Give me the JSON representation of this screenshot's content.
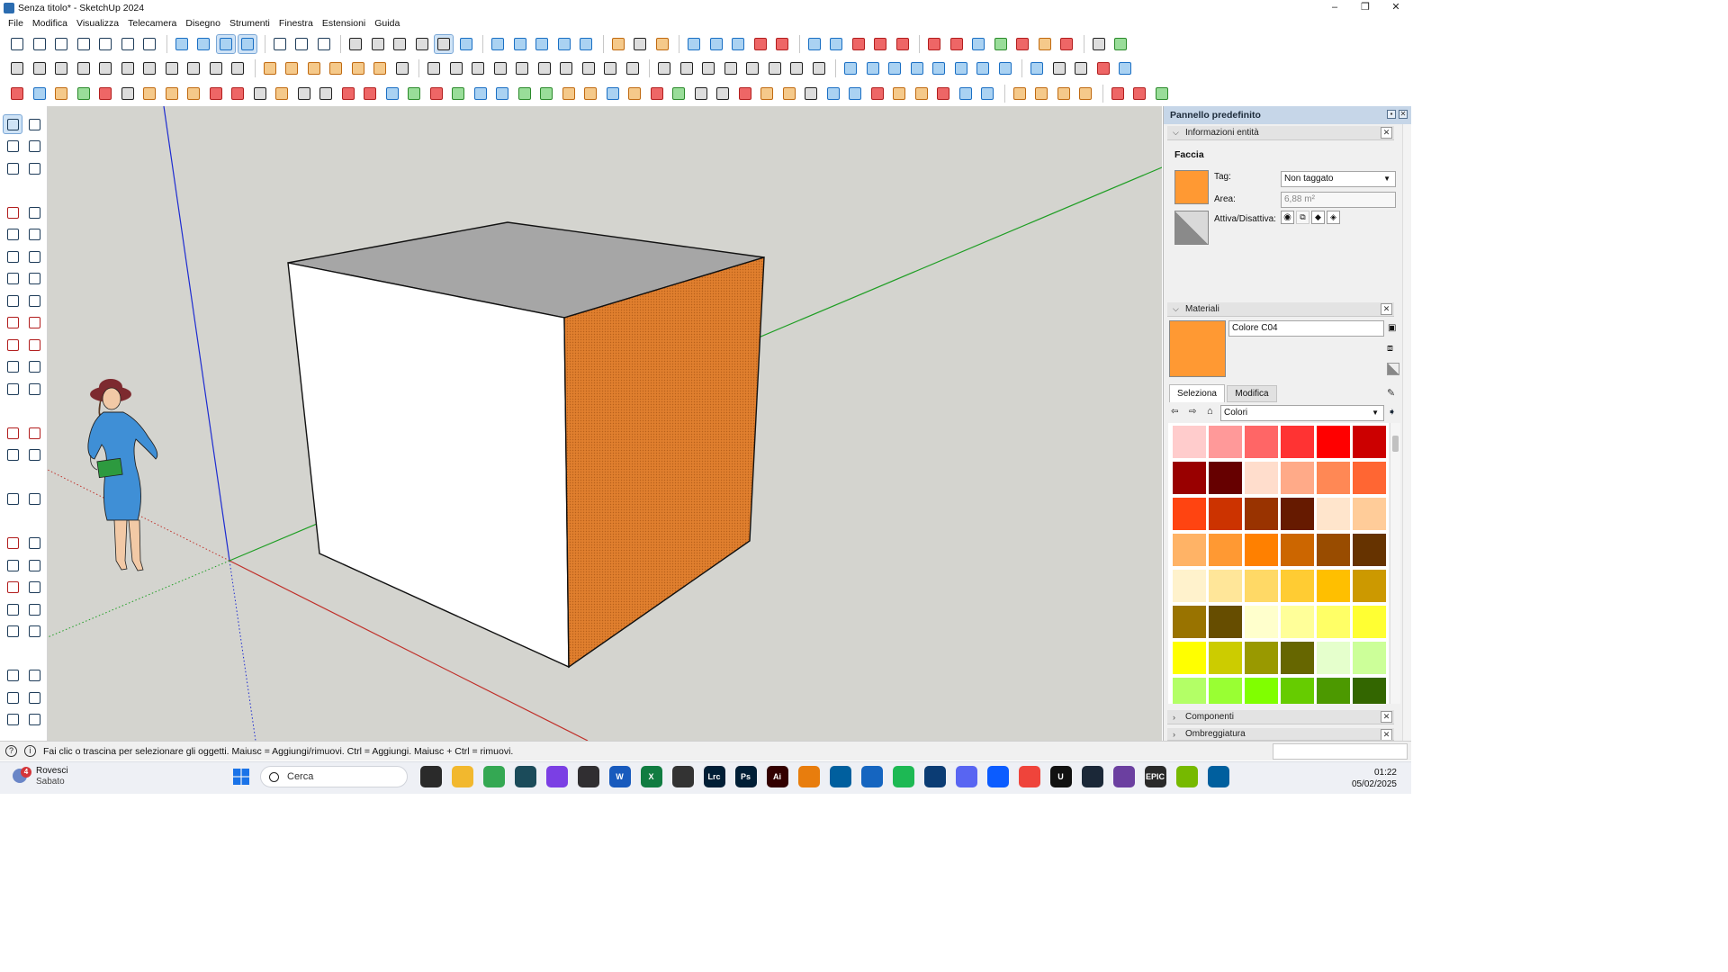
{
  "window": {
    "title": "Senza titolo* - SketchUp 2024",
    "controls": [
      "–",
      "❐",
      "✕"
    ]
  },
  "menu": [
    "File",
    "Modifica",
    "Visualizza",
    "Telecamera",
    "Disegno",
    "Strumenti",
    "Finestra",
    "Estensioni",
    "Guida"
  ],
  "right_panel": {
    "title": "Pannello predefinito",
    "entity_info": {
      "header": "Informazioni entità",
      "entity_type": "Faccia",
      "tag_label": "Tag:",
      "tag_value": "Non taggato",
      "area_label": "Area:",
      "area_value": "6,88 m²",
      "toggle_label": "Attiva/Disattiva:",
      "face_color": "#ff9933"
    },
    "materials": {
      "header": "Materiali",
      "material_name": "Colore C04",
      "current_color": "#ff9933",
      "tab_select": "Seleziona",
      "tab_edit": "Modifica",
      "library": "Colori",
      "swatches": [
        "#ffcccc",
        "#ff9999",
        "#ff6666",
        "#ff3333",
        "#ff0000",
        "#cc0000",
        "#990000",
        "#660000",
        "#ffddcc",
        "#ffaa88",
        "#ff8855",
        "#ff6633",
        "#ff4411",
        "#cc3300",
        "#993300",
        "#661a00",
        "#ffe5cc",
        "#ffcc99",
        "#ffb366",
        "#ff9933",
        "#ff8000",
        "#cc6600",
        "#994c00",
        "#663300",
        "#fff2cc",
        "#ffe699",
        "#ffd966",
        "#ffcc33",
        "#ffbf00",
        "#cc9900",
        "#997300",
        "#664d00",
        "#ffffcc",
        "#ffff99",
        "#ffff66",
        "#ffff33",
        "#ffff00",
        "#cccc00",
        "#999900",
        "#666600",
        "#e5ffcc",
        "#ccff99",
        "#b3ff66",
        "#99ff33",
        "#80ff00",
        "#66cc00",
        "#4c9900",
        "#336600"
      ]
    },
    "components_header": "Componenti",
    "shadows_header": "Ombreggiatura"
  },
  "status": {
    "message": "Fai clic o trascina per selezionare gli oggetti. Maiusc = Aggiungi/rimuovi. Ctrl = Aggiungi. Maiusc + Ctrl = rimuovi."
  },
  "taskbar": {
    "weather_badge": "4",
    "weather_title": "Rovesci",
    "weather_subtitle": "Sabato",
    "search_placeholder": "Cerca",
    "time": "01:22",
    "date": "05/02/2025",
    "apps": [
      {
        "name": "task-view-icon",
        "color": "#2a2a2a",
        "label": ""
      },
      {
        "name": "file-explorer-icon",
        "color": "#f2b82e",
        "label": ""
      },
      {
        "name": "chrome-icon",
        "color": "#34a853",
        "label": ""
      },
      {
        "name": "terminal-icon",
        "color": "#1b4b5a",
        "label": ""
      },
      {
        "name": "headphones-icon",
        "color": "#7b3fe4",
        "label": ""
      },
      {
        "name": "obs-icon",
        "color": "#302e31",
        "label": ""
      },
      {
        "name": "word-icon",
        "color": "#185abd",
        "label": "W"
      },
      {
        "name": "excel-icon",
        "color": "#107c41",
        "label": "X"
      },
      {
        "name": "davinci-icon",
        "color": "#333333",
        "label": ""
      },
      {
        "name": "lightroom-icon",
        "color": "#001e36",
        "label": "Lrc"
      },
      {
        "name": "photoshop-icon",
        "color": "#001e36",
        "label": "Ps"
      },
      {
        "name": "illustrator-icon",
        "color": "#330000",
        "label": "Ai"
      },
      {
        "name": "blender-icon",
        "color": "#e87d0d",
        "label": ""
      },
      {
        "name": "sketchup-icon",
        "color": "#005f9e",
        "label": ""
      },
      {
        "name": "layers-icon",
        "color": "#1565c0",
        "label": ""
      },
      {
        "name": "spotify-icon",
        "color": "#1db954",
        "label": ""
      },
      {
        "name": "webex-icon",
        "color": "#0b3c74",
        "label": ""
      },
      {
        "name": "discord-icon",
        "color": "#5865f2",
        "label": ""
      },
      {
        "name": "zoom-icon",
        "color": "#0b5cff",
        "label": ""
      },
      {
        "name": "anydesk-icon",
        "color": "#ef443b",
        "label": ""
      },
      {
        "name": "unreal-icon",
        "color": "#111111",
        "label": "U"
      },
      {
        "name": "steam-icon",
        "color": "#1b2838",
        "label": ""
      },
      {
        "name": "gog-icon",
        "color": "#6b3fa0",
        "label": ""
      },
      {
        "name": "epic-icon",
        "color": "#2a2a2a",
        "label": "EPIC"
      },
      {
        "name": "nvidia-icon",
        "color": "#76b900",
        "label": ""
      },
      {
        "name": "sketchup-active-icon",
        "color": "#005f9e",
        "label": ""
      }
    ]
  },
  "colors": {
    "viewport_bg": "#d4d4cf",
    "front_face": "#ffffff",
    "top_face": "#a6a6a6",
    "side_face": "#e07f2e",
    "axis_red": "#c0312b",
    "axis_green": "#1f9e24",
    "axis_blue": "#1d2bd1"
  }
}
